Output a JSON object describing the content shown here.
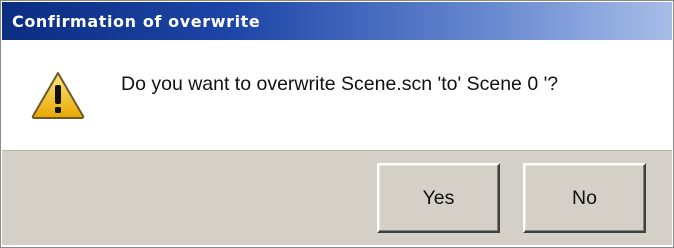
{
  "dialog": {
    "title": "Confirmation of overwrite",
    "icon": "warning-icon",
    "message": "Do you want to overwrite Scene.scn 'to' Scene 0 '?",
    "buttons": {
      "yes_label": "Yes",
      "no_label": "No"
    }
  },
  "colors": {
    "title_bar_start": "#0b2d82",
    "title_bar_end": "#a7bde7",
    "button_face": "#d4d0c8",
    "warning_fill": "#f3c623"
  }
}
